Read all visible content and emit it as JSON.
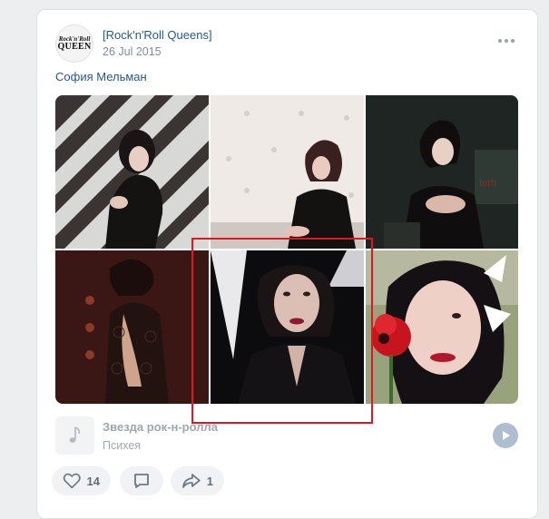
{
  "post": {
    "group_name": "[Rock'n'Roll Queens]",
    "date": "26 Jul 2015",
    "author": "София Мельман",
    "avatar_logo": {
      "line1": "Rock'n'Roll",
      "line2": "QUEEN"
    },
    "more_icon": "more-horizontal-icon"
  },
  "photos": [
    {
      "name": "photo-1",
      "description": "woman in black lace dress against zigzag wall"
    },
    {
      "name": "photo-2",
      "description": "woman at white tufted wall"
    },
    {
      "name": "photo-3",
      "description": "performer on dark stage"
    },
    {
      "name": "photo-4",
      "description": "woman in lace dress, back view"
    },
    {
      "name": "photo-5",
      "description": "portrait of woman with dark hair"
    },
    {
      "name": "photo-6",
      "description": "woman holding red tulip"
    }
  ],
  "audio": {
    "title": "Звезда рок-н-ролла",
    "artist": "Психея",
    "icon": "music-note-icon",
    "play_icon": "play-icon"
  },
  "actions": {
    "likes": "14",
    "comments": "",
    "shares": "1"
  },
  "colors": {
    "link": "#2a5885",
    "secondary": "#818c99",
    "highlight": "#e0171b",
    "background": "#edeef0"
  }
}
